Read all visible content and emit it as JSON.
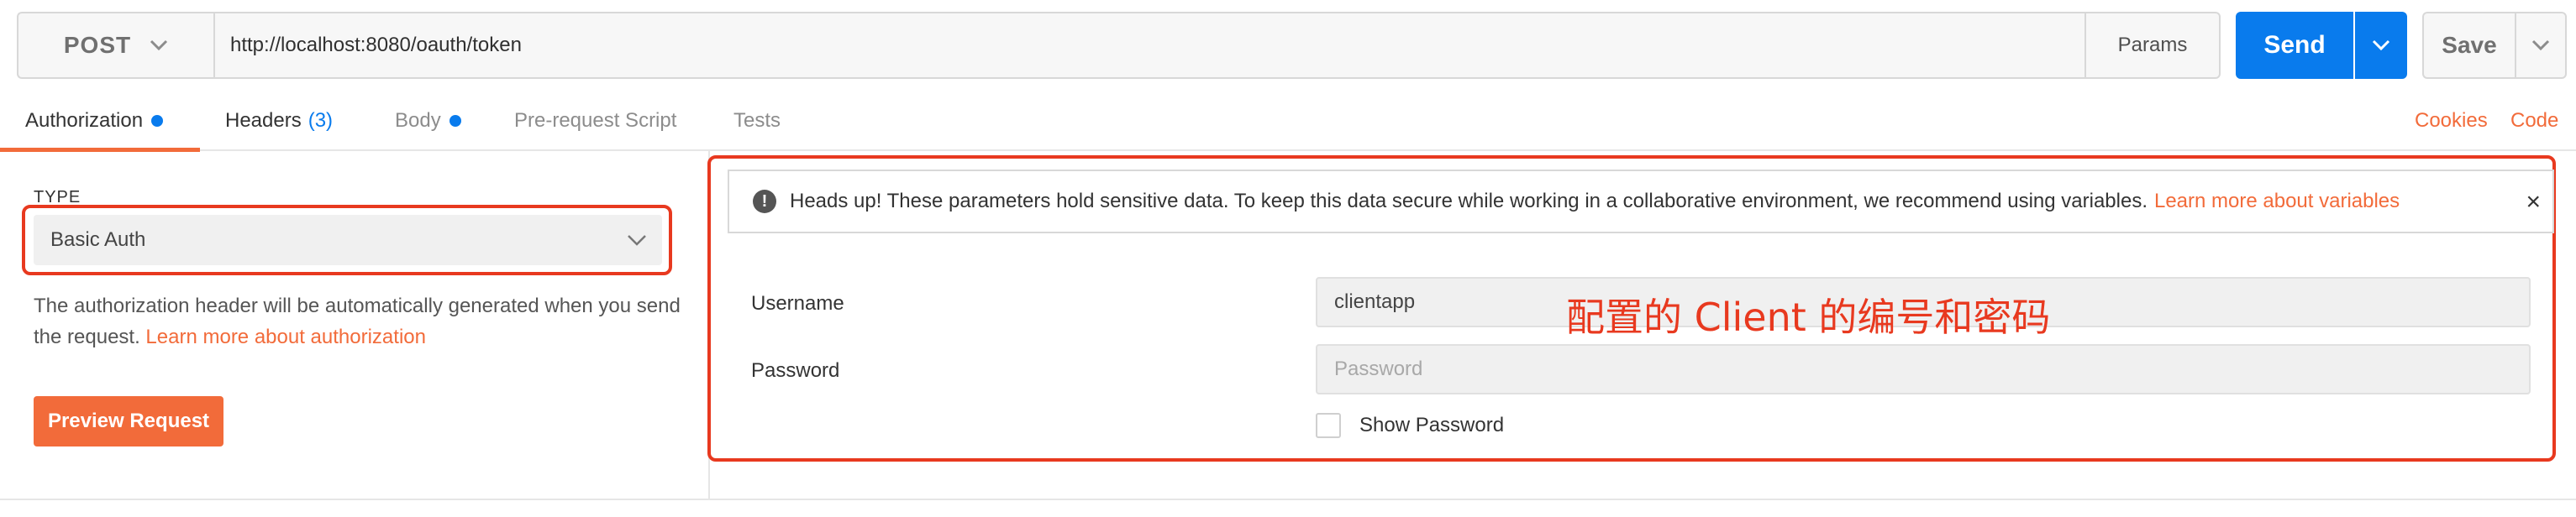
{
  "request": {
    "method": "POST",
    "url": "http://localhost:8080/oauth/token",
    "params_label": "Params",
    "send_label": "Send",
    "save_label": "Save"
  },
  "tabs": [
    {
      "label": "Authorization",
      "active": true,
      "dot": true
    },
    {
      "label": "Headers",
      "count": "(3)"
    },
    {
      "label": "Body",
      "dot": true
    },
    {
      "label": "Pre-request Script"
    },
    {
      "label": "Tests"
    }
  ],
  "links": {
    "cookies": "Cookies",
    "code": "Code"
  },
  "auth": {
    "type_label": "TYPE",
    "type_value": "Basic Auth",
    "description": "The authorization header will be automatically generated when you send the request.",
    "learn_more": "Learn more about authorization",
    "preview_button": "Preview Request"
  },
  "alert": {
    "text": "Heads up! These parameters hold sensitive data. To keep this data secure while working in a collaborative environment, we recommend using variables.",
    "link": "Learn more about variables",
    "close": "×"
  },
  "fields": {
    "username_label": "Username",
    "username_value": "clientapp",
    "password_label": "Password",
    "password_placeholder": "Password",
    "show_password_label": "Show Password"
  },
  "annotation": "配置的 Client 的编号和密码",
  "colors": {
    "accent": "#097bed",
    "link": "#f26b3a",
    "highlight": "#e8391f"
  }
}
